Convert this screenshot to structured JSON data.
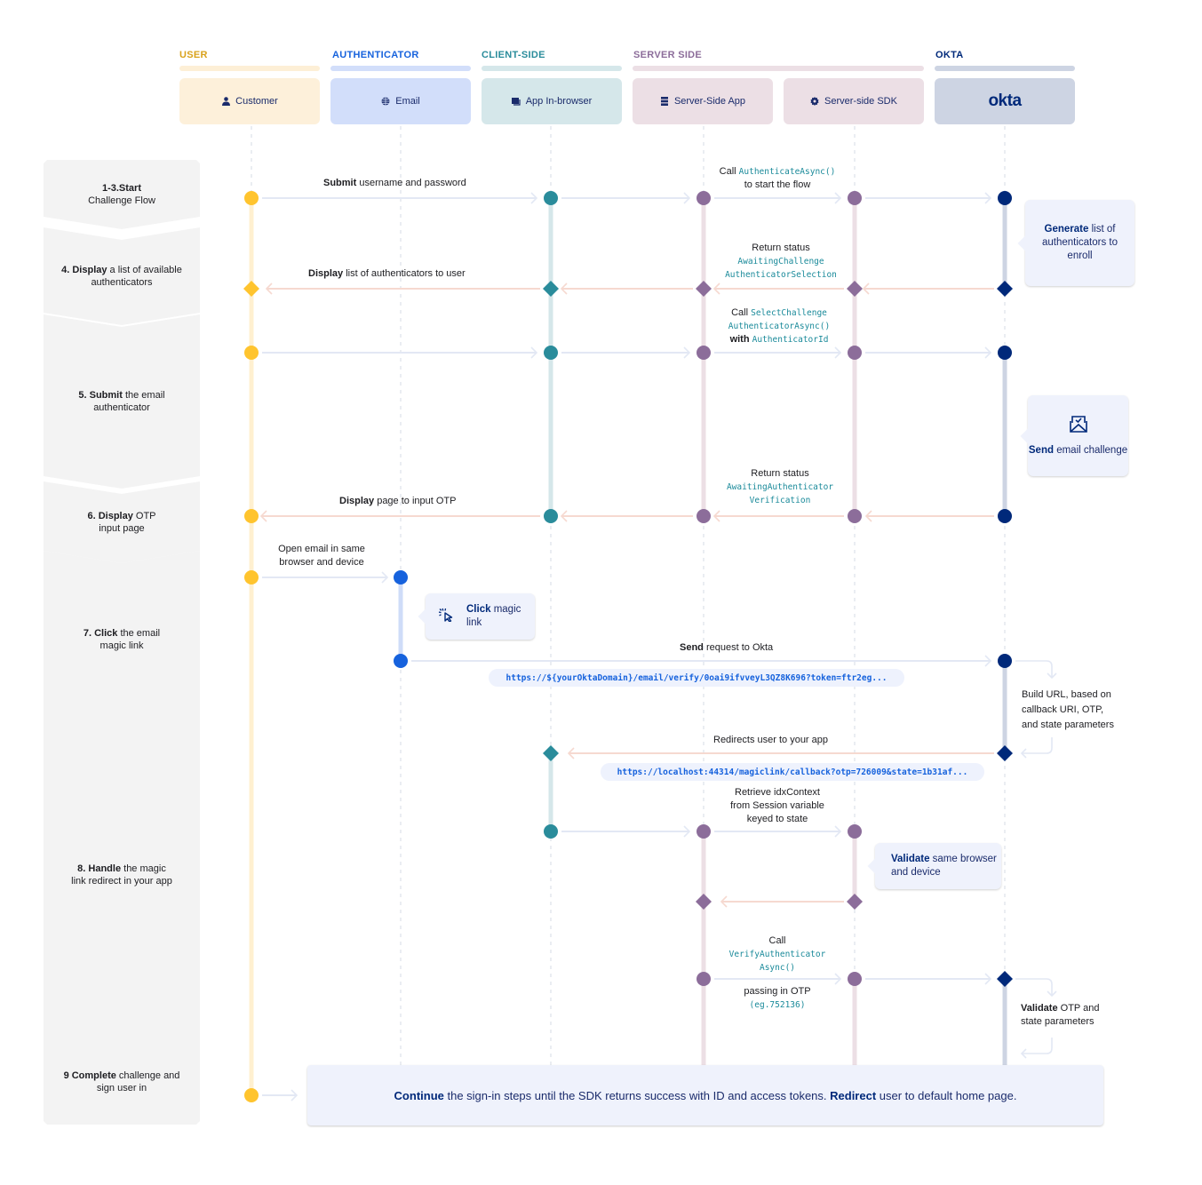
{
  "lanes": [
    {
      "title": "USER",
      "color": "#d9a21b",
      "bar": "#fdefd6"
    },
    {
      "title": "AUTHENTICATOR",
      "color": "#1662dd",
      "bar": "#d2defa"
    },
    {
      "title": "CLIENT-SIDE",
      "color": "#2a8c9b",
      "bar": "#d5e7ea"
    },
    {
      "title": "SERVER SIDE",
      "color": "#8c6d9a",
      "bar": "#ecdfe5"
    },
    {
      "title": "OKTA",
      "color": "#00297a",
      "bar": "#cdd4e3"
    }
  ],
  "actors": [
    {
      "label": "Customer",
      "icon": "user-icon",
      "bg": "#fdf0da"
    },
    {
      "label": "Email",
      "icon": "globe-icon",
      "bg": "#d2defa"
    },
    {
      "label": "App In-browser",
      "icon": "browser-window-icon",
      "bg": "#d5e7ea"
    },
    {
      "label": "Server-Side App",
      "icon": "server-icon",
      "bg": "#ecdfe5"
    },
    {
      "label": "Server-side SDK",
      "icon": "gear-icon",
      "bg": "#ecdfe5"
    },
    {
      "label": "okta",
      "icon": "okta-logo",
      "bg": "#cdd4e3"
    }
  ],
  "steps": [
    {
      "bold": "1-3.Start",
      "text": "Challenge Flow"
    },
    {
      "bold": "4. Display",
      "text": " a list of available authenticators"
    },
    {
      "bold": "5. Submit",
      "text": " the email authenticator"
    },
    {
      "bold": "6. Display",
      "text": " OTP input page"
    },
    {
      "bold": "7. Click",
      "text": " the email magic link"
    },
    {
      "bold": "8. Handle",
      "text": " the magic link redirect in your app"
    },
    {
      "bold": "9 Complete",
      "text": " challenge and sign user in"
    }
  ],
  "messages": {
    "submit_credentials": {
      "bold": "Submit",
      "text": " username and password"
    },
    "call_authenticate": {
      "text": "Call ",
      "code": "AuthenticateAsync()",
      "text2": "to start the flow"
    },
    "return_status_1": {
      "text": "Return status",
      "code1": "AwaitingChallenge",
      "code2": "AuthenticatorSelection"
    },
    "display_list": {
      "bold": "Display",
      "text": " list of authenticators to user"
    },
    "call_select": {
      "text": "Call ",
      "code1": "SelectChallenge",
      "code2": "AuthenticatorAsync()",
      "with": "with",
      "code3": "AuthenticatorId"
    },
    "return_status_2": {
      "text": "Return status",
      "code1": "AwaitingAuthenticator",
      "code2": "Verification"
    },
    "display_otp": {
      "bold": "Display",
      "text": " page to input OTP"
    },
    "open_email": {
      "line1": "Open email in same",
      "line2": "browser and device"
    },
    "send_request": {
      "bold": "Send",
      "text": " request to Okta"
    },
    "verify_url": "https://${yourOktaDomain}/email/verify/0oai9ifvveyL3QZ8K696?token=ftr2eg...",
    "redirects": "Redirects user to your app",
    "callback_url": "https://localhost:44314/magiclink/callback?otp=726009&state=1b31af...",
    "retrieve": {
      "line1": "Retrieve idxContext",
      "line2": "from Session variable",
      "line3": "keyed to state"
    },
    "call_verify": {
      "text": "Call",
      "code1": "VerifyAuthenticator",
      "code2": "Async()"
    },
    "passing_otp": {
      "text": "passing in OTP",
      "code": "(eg.752136)"
    }
  },
  "notes": {
    "generate": {
      "bold": "Generate",
      "text": " list of authenticators to enroll"
    },
    "send_email": {
      "bold": "Send",
      "text": " email challenge",
      "icon": "envelope-check-icon"
    },
    "click_link": {
      "bold": "Click",
      "text": " magic link",
      "icon": "cursor-click-icon"
    },
    "validate_browser": {
      "bold": "Validate",
      "text": " same browser and device"
    },
    "build_url": {
      "line1": "Build URL, based on",
      "line2": "callback URI, OTP,",
      "line3": "and state parameters"
    },
    "validate_otp": {
      "bold": "Validate",
      "text": " OTP and",
      "line2": "state parameters"
    }
  },
  "final": {
    "bold1": "Continue",
    "text1": " the sign-in steps until the SDK returns success with ID and access tokens. ",
    "bold2": "Redirect",
    "text2": " user to default home page."
  },
  "colors": {
    "user": "#ffc42e",
    "authenticator": "#1662dd",
    "client": "#2a8c9b",
    "server": "#8c6d9a",
    "okta": "#00297a",
    "forward_arrow": "#e3e8f4",
    "return_arrow": "#f6d9d0"
  }
}
